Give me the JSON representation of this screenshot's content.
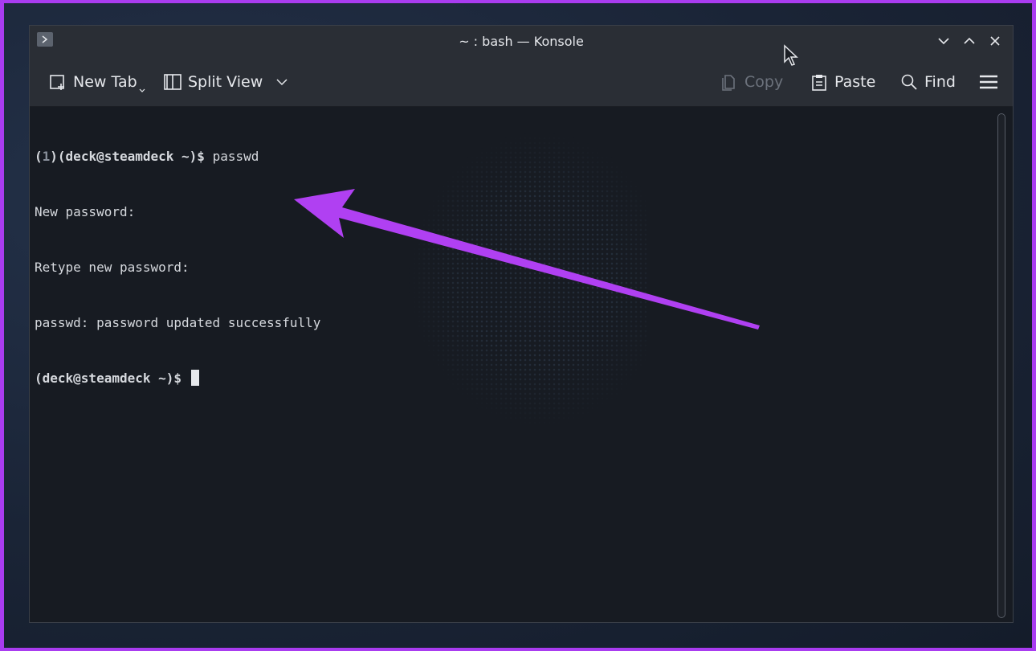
{
  "window": {
    "title": "~ : bash — Konsole"
  },
  "toolbar": {
    "new_tab_label": "New Tab",
    "split_view_label": "Split View",
    "copy_label": "Copy",
    "paste_label": "Paste",
    "find_label": "Find"
  },
  "terminal": {
    "line1_prefix": "(",
    "line1_count": "1",
    "line1_prompt": ")(deck@steamdeck ~)$",
    "line1_command": " passwd",
    "line2": "New password:",
    "line3": "Retype new password:",
    "line4": "passwd: password updated successfully",
    "line5_prompt": "(deck@steamdeck ~)$"
  },
  "colors": {
    "accent_arrow": "#b040f2",
    "frame": "#a93cf0",
    "terminal_bg": "#171b22",
    "toolbar_bg": "#2a2e35"
  },
  "icons": {
    "app": "konsole-icon",
    "minimize": "chevron-down-icon",
    "maximize": "chevron-up-icon",
    "close": "close-icon",
    "new_tab": "new-tab-icon",
    "split_view": "split-view-icon",
    "copy": "copy-icon",
    "paste": "paste-icon",
    "find": "search-icon",
    "menu": "hamburger-menu-icon"
  }
}
